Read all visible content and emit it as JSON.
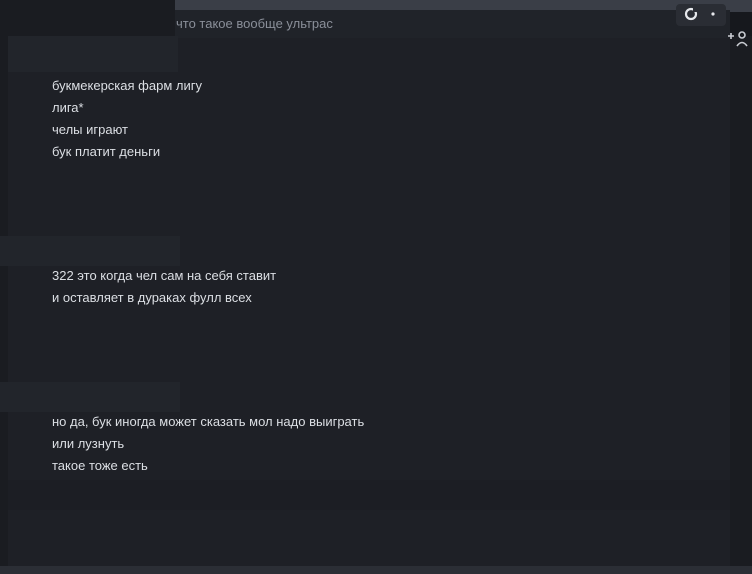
{
  "header": {
    "reply_preview": "что такое вообще ультрас",
    "actions": {
      "refresh_icon": "refresh-icon",
      "more_icon": "more-vertical-icon",
      "add_reaction_icon": "add-reaction-icon"
    }
  },
  "messages": [
    {
      "lines": [
        "букмекерская фарм лигу",
        "лига*",
        "челы играют",
        "бук платит деньги"
      ]
    },
    {
      "lines": [
        "322 это когда чел сам на себя ставит",
        "и оставляет в дураках фулл всех"
      ]
    },
    {
      "lines": [
        "но да, бук иногда может сказать мол надо выиграть",
        "или лузнуть",
        "такое тоже есть"
      ]
    }
  ],
  "colors": {
    "background": "#1e2026",
    "text": "#dcdfe4",
    "muted_text": "#8a8f99"
  }
}
